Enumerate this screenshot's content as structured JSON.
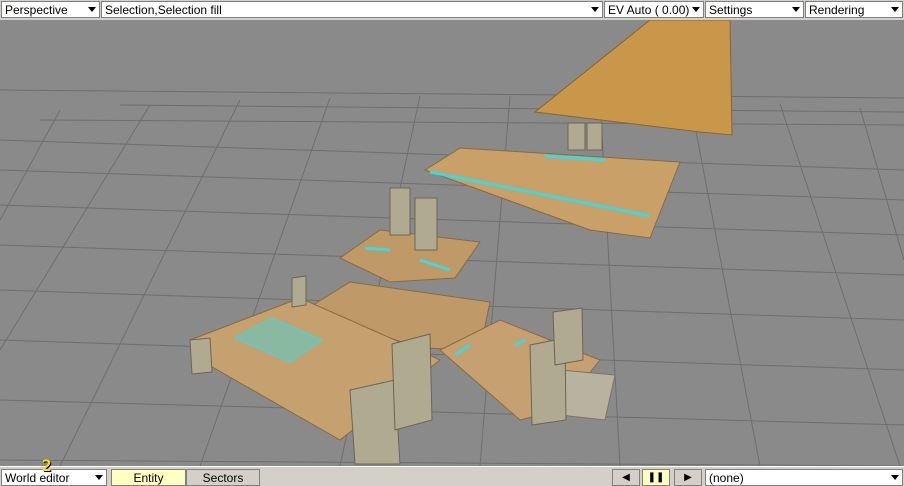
{
  "toolbar": {
    "view_mode": "Perspective",
    "selection_mode": "Selection,Selection fill",
    "exposure": "EV Auto ( 0.00)",
    "settings": "Settings",
    "rendering": "Rendering"
  },
  "bottom": {
    "editor_mode": "World editor",
    "tabs": [
      "Entity",
      "Sectors"
    ],
    "active_tab": "Entity",
    "play_controls": {
      "prev": "◀",
      "pause": "❚❚",
      "next": "▶"
    },
    "selection_value": "(none)"
  },
  "overlay": {
    "level_number": "2"
  },
  "colors": {
    "viewport_bg": "#8a8a8a",
    "grid": "#6e6e6e",
    "sand": "#c8a068",
    "pyramid": "#c9974a",
    "highlight": "#40d8e0",
    "pillar": "#b0aa90"
  }
}
